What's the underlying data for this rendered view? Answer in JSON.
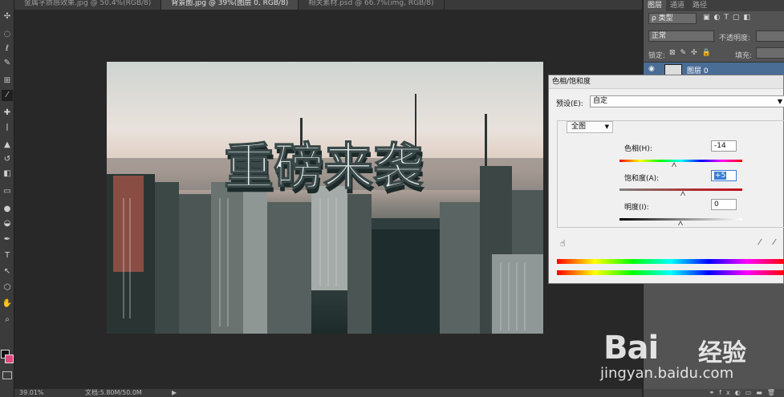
{
  "app": {
    "document_tabs": [
      {
        "label": "金属字质感效果.jpg @ 50.4%(RGB/8)",
        "active": false
      },
      {
        "label": "背景图.jpg @ 39%(图层 0, RGB/8)",
        "active": true
      },
      {
        "label": "相关素材.psd @ 66.7%(img, RGB/8)",
        "active": false
      }
    ],
    "status": {
      "zoom": "39.01%",
      "doc_size": "文档:5.80M/50.0M"
    }
  },
  "toolbar": {
    "tools": [
      {
        "name": "move-tool-icon",
        "glyph": "✣"
      },
      {
        "name": "marquee-tool-icon",
        "glyph": "◌"
      },
      {
        "name": "lasso-tool-icon",
        "glyph": "ℓ"
      },
      {
        "name": "quick-select-tool-icon",
        "glyph": "✎"
      },
      {
        "name": "crop-tool-icon",
        "glyph": "⊞"
      },
      {
        "name": "eyedropper-tool-icon",
        "glyph": "⁄"
      },
      {
        "name": "healing-tool-icon",
        "glyph": "✚"
      },
      {
        "name": "brush-tool-icon",
        "glyph": "ǀ"
      },
      {
        "name": "stamp-tool-icon",
        "glyph": "▲"
      },
      {
        "name": "history-brush-icon",
        "glyph": "↺"
      },
      {
        "name": "eraser-tool-icon",
        "glyph": "◧"
      },
      {
        "name": "gradient-tool-icon",
        "glyph": "▭"
      },
      {
        "name": "blur-tool-icon",
        "glyph": "●"
      },
      {
        "name": "dodge-tool-icon",
        "glyph": "◒"
      },
      {
        "name": "pen-tool-icon",
        "glyph": "✒"
      },
      {
        "name": "type-tool-icon",
        "glyph": "T"
      },
      {
        "name": "path-select-tool-icon",
        "glyph": "↖"
      },
      {
        "name": "shape-tool-icon",
        "glyph": "⬡"
      },
      {
        "name": "hand-tool-icon",
        "glyph": "✋"
      },
      {
        "name": "zoom-tool-icon",
        "glyph": "⌕"
      }
    ],
    "fg_color": "#111111",
    "bg_color": "#e0497f"
  },
  "layers_panel": {
    "tabs": [
      "图层",
      "通道",
      "路径"
    ],
    "kind_label": "ρ 类型",
    "blend_mode": "正常",
    "opacity_label": "不透明度:",
    "lock_label": "锁定:",
    "fill_label": "填充:",
    "layer_name": "图层 0"
  },
  "canvas": {
    "headline": "重磅来袭"
  },
  "dialog": {
    "title": "色相/饱和度",
    "preset_label": "预设(E):",
    "preset_value": "自定",
    "channel": "全图",
    "sliders": [
      {
        "label": "色相(H):",
        "value": "-14",
        "position": 0.45,
        "track": "hue",
        "focused": false
      },
      {
        "label": "饱和度(A):",
        "value": "+5",
        "position": 0.52,
        "track": "sat",
        "focused": true
      },
      {
        "label": "明度(I):",
        "value": "0",
        "position": 0.5,
        "track": "light",
        "focused": false
      }
    ]
  },
  "watermark": {
    "brand": "Bai",
    "brand_suffix": "经验",
    "url": "jingyan.baidu.com"
  }
}
